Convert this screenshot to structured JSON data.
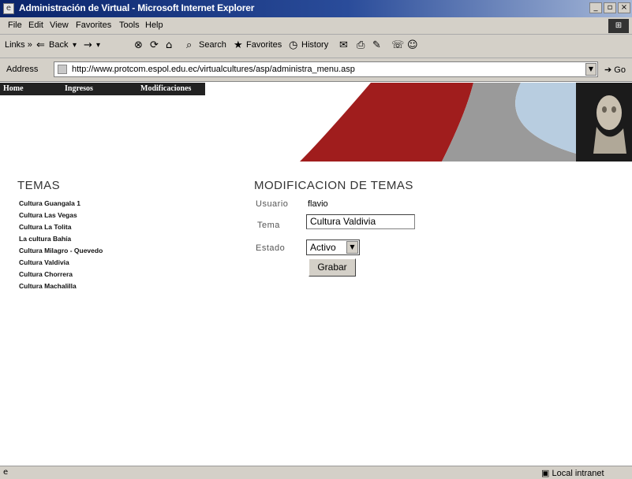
{
  "window": {
    "title": "Administración de Virtual - Microsoft Internet Explorer",
    "controls": {
      "minimize": "_",
      "maximize": "▫",
      "close": "×"
    }
  },
  "menubar": {
    "items": [
      "File",
      "Edit",
      "View",
      "Favorites",
      "Tools",
      "Help"
    ]
  },
  "toolbar": {
    "links": "Links",
    "back": "Back",
    "search": "Search",
    "favorites": "Favorites",
    "history": "History"
  },
  "address": {
    "label": "Address",
    "url": "http://www.protcom.espol.edu.ec/virtualcultures/asp/administra_menu.asp",
    "go": "Go"
  },
  "site_nav": {
    "home": "Home",
    "ingresos": "Ingresos",
    "modificaciones": "Modificaciones"
  },
  "temas": {
    "heading": "TEMAS",
    "items": [
      "Cultura Guangala 1",
      "Cultura Las Vegas",
      "Cultura La Tolita",
      "La cultura Bahía",
      "Cultura Milagro - Quevedo",
      "Cultura Valdivia",
      "Cultura Chorrera",
      "Cultura Machalilla"
    ]
  },
  "form": {
    "heading": "MODIFICACION DE TEMAS",
    "usuario_label": "Usuario",
    "usuario_value": "flavio",
    "tema_label": "Tema",
    "tema_value": "Cultura Valdivia",
    "estado_label": "Estado",
    "estado_value": "Activo",
    "submit_label": "Grabar"
  },
  "status": {
    "zone": "Local intranet"
  },
  "colors": {
    "titlebar": "#0a246a",
    "chrome": "#d4d0c8",
    "nav": "#222222",
    "banner_red": "#a01d1d",
    "banner_gray": "#9a9a9a",
    "banner_blue": "#b8cde0"
  }
}
